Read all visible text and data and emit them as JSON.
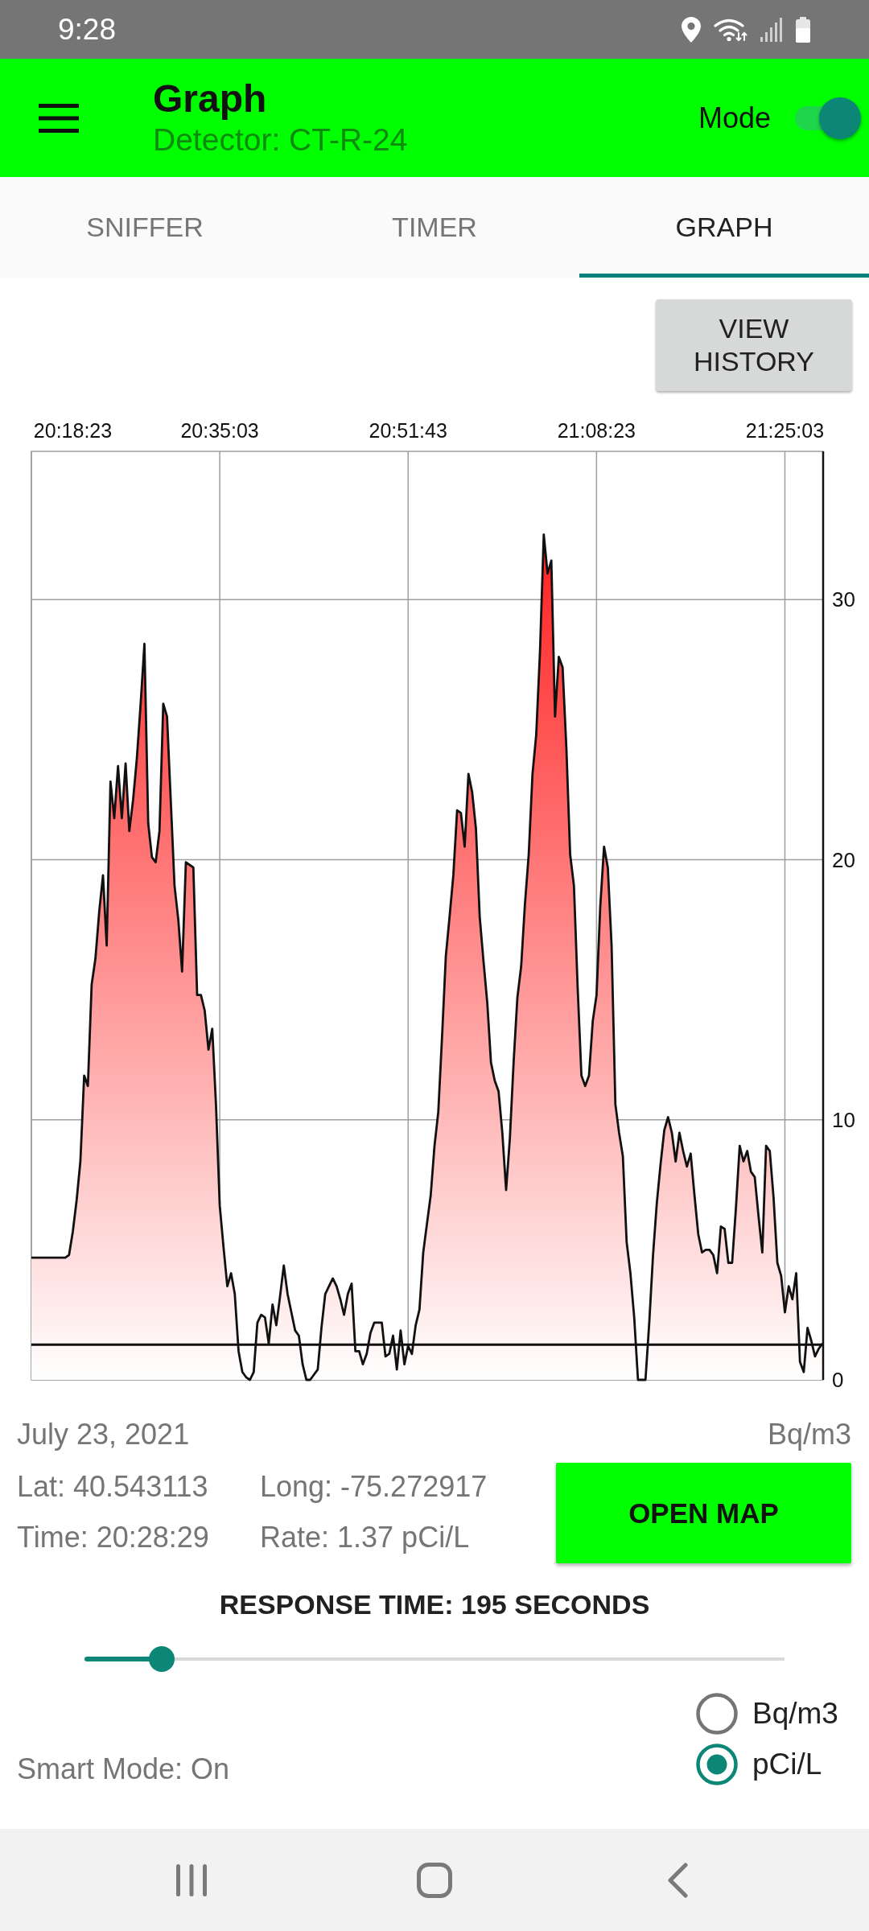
{
  "status_bar": {
    "time": "9:28"
  },
  "app_bar": {
    "title": "Graph",
    "subtitle": "Detector: CT-R-24",
    "mode_label": "Mode",
    "mode_switch": {
      "on": true
    }
  },
  "tabs": [
    {
      "label": "SNIFFER",
      "selected": false
    },
    {
      "label": "TIMER",
      "selected": false
    },
    {
      "label": "GRAPH",
      "selected": true
    }
  ],
  "view_history_button": "VIEW HISTORY",
  "chart": {
    "chart_data": {
      "type": "area",
      "grid": true,
      "categories": [
        null,
        null,
        null,
        null,
        null,
        null,
        null,
        null,
        null,
        null,
        null,
        "20:18:23",
        null,
        null,
        null,
        null,
        null,
        null,
        null,
        null,
        null,
        null,
        null,
        null,
        null,
        null,
        null,
        null,
        null,
        null,
        null,
        null,
        null,
        null,
        null,
        null,
        null,
        null,
        null,
        null,
        null,
        null,
        null,
        null,
        null,
        null,
        null,
        null,
        null,
        null,
        "20:35:03",
        null,
        null,
        null,
        null,
        null,
        null,
        null,
        null,
        null,
        null,
        null,
        null,
        null,
        null,
        null,
        null,
        null,
        null,
        null,
        null,
        null,
        null,
        null,
        null,
        null,
        null,
        null,
        null,
        null,
        null,
        null,
        null,
        null,
        null,
        null,
        null,
        null,
        null,
        null,
        null,
        null,
        null,
        null,
        null,
        null,
        null,
        null,
        null,
        null,
        "20:51:43",
        null,
        null,
        null,
        null,
        null,
        null,
        null,
        null,
        null,
        null,
        null,
        null,
        null,
        null,
        null,
        null,
        null,
        null,
        null,
        null,
        null,
        null,
        null,
        null,
        null,
        null,
        null,
        null,
        null,
        null,
        null,
        null,
        null,
        null,
        null,
        null,
        null,
        null,
        null,
        null,
        null,
        null,
        null,
        null,
        null,
        null,
        null,
        null,
        null,
        "21:08:23",
        null,
        null,
        null,
        null,
        null,
        null,
        null,
        null,
        null,
        null,
        null,
        null,
        null,
        null,
        null,
        null,
        null,
        null,
        null,
        null,
        null,
        null,
        null,
        null,
        null,
        null,
        null,
        null,
        null,
        null,
        null,
        null,
        null,
        null,
        null,
        null,
        null,
        null,
        null,
        null,
        null,
        null,
        null,
        null,
        null,
        null,
        null,
        null,
        null,
        "21:25:03",
        null,
        null,
        null,
        null,
        null,
        null,
        null,
        null,
        null,
        null
      ],
      "values": [
        4.7,
        4.7,
        4.7,
        4.7,
        4.7,
        4.7,
        4.7,
        4.7,
        4.7,
        4.7,
        4.8,
        5.7,
        6.9,
        8.4,
        11.7,
        11.3,
        15.2,
        16.2,
        18.0,
        19.4,
        16.7,
        23.0,
        21.6,
        23.6,
        21.6,
        23.7,
        21.1,
        22.3,
        23.9,
        26.0,
        28.3,
        21.4,
        20.1,
        19.9,
        21.1,
        26.0,
        25.5,
        22.3,
        19.0,
        17.7,
        15.7,
        19.9,
        19.8,
        19.7,
        14.8,
        14.8,
        14.2,
        12.7,
        13.5,
        10.6,
        6.7,
        5.1,
        3.6,
        4.1,
        3.3,
        1.1,
        0.3,
        0.1,
        0,
        0.3,
        2.2,
        2.5,
        2.4,
        1.4,
        2.9,
        2.1,
        3.2,
        4.4,
        3.3,
        2.6,
        1.9,
        1.7,
        0.6,
        0,
        0,
        0.2,
        0.4,
        2.0,
        3.3,
        3.6,
        3.9,
        3.6,
        3.1,
        2.5,
        3.3,
        3.7,
        1.1,
        1.1,
        0.6,
        1.0,
        1.8,
        2.2,
        2.2,
        2.2,
        0.9,
        1.0,
        1.7,
        0.4,
        1.9,
        0.6,
        1.3,
        1.0,
        2.1,
        2.7,
        4.9,
        6.0,
        7.1,
        9.0,
        10.3,
        13.2,
        16.3,
        17.8,
        19.4,
        21.9,
        21.8,
        20.5,
        23.3,
        22.6,
        21.2,
        17.8,
        16.1,
        14.5,
        12.2,
        11.5,
        11.1,
        9.5,
        7.3,
        9.3,
        12.2,
        14.7,
        15.9,
        18.3,
        20.2,
        23.3,
        24.8,
        28.0,
        32.5,
        31.0,
        31.5,
        25.5,
        27.8,
        27.4,
        24.3,
        20.2,
        19.0,
        15.1,
        11.7,
        11.3,
        11.7,
        13.8,
        14.8,
        18.2,
        20.5,
        19.7,
        16.7,
        10.6,
        9.5,
        8.6,
        5.3,
        4.1,
        2.4,
        0,
        0,
        0,
        2.2,
        4.8,
        6.8,
        8.3,
        9.6,
        10.1,
        9.5,
        8.4,
        9.5,
        8.8,
        8.2,
        8.7,
        7.1,
        5.6,
        4.9,
        5.0,
        5.0,
        4.8,
        4.1,
        5.9,
        5.8,
        4.5,
        4.5,
        6.6,
        9.0,
        8.4,
        8.8,
        8.0,
        7.8,
        6.3,
        4.9,
        9.0,
        8.8,
        7.0,
        4.5,
        4.0,
        2.6,
        3.6,
        3.1,
        4.1,
        0.7,
        0.3,
        2.0,
        1.5,
        0.9,
        1.2,
        1.4
      ],
      "ylim": [
        0,
        35.7
      ],
      "yticks": [
        0,
        10,
        20,
        30
      ],
      "ref_lines": [
        {
          "axis": "y",
          "value": 1.35
        }
      ]
    }
  },
  "info": {
    "date": "July 23, 2021",
    "unit": "Bq/m3",
    "lat": "Lat: 40.543113",
    "long": "Long: -75.272917",
    "time": "Time: 20:28:29",
    "rate": "Rate: 1.37 pCi/L"
  },
  "open_map_button": "OPEN MAP",
  "response_time": {
    "label": "RESPONSE TIME: 195 SECONDS",
    "level": 0.11
  },
  "units": [
    {
      "label": "Bq/m3",
      "selected": false
    },
    {
      "label": "pCi/L",
      "selected": true
    }
  ],
  "smart_mode": "Smart Mode: On"
}
